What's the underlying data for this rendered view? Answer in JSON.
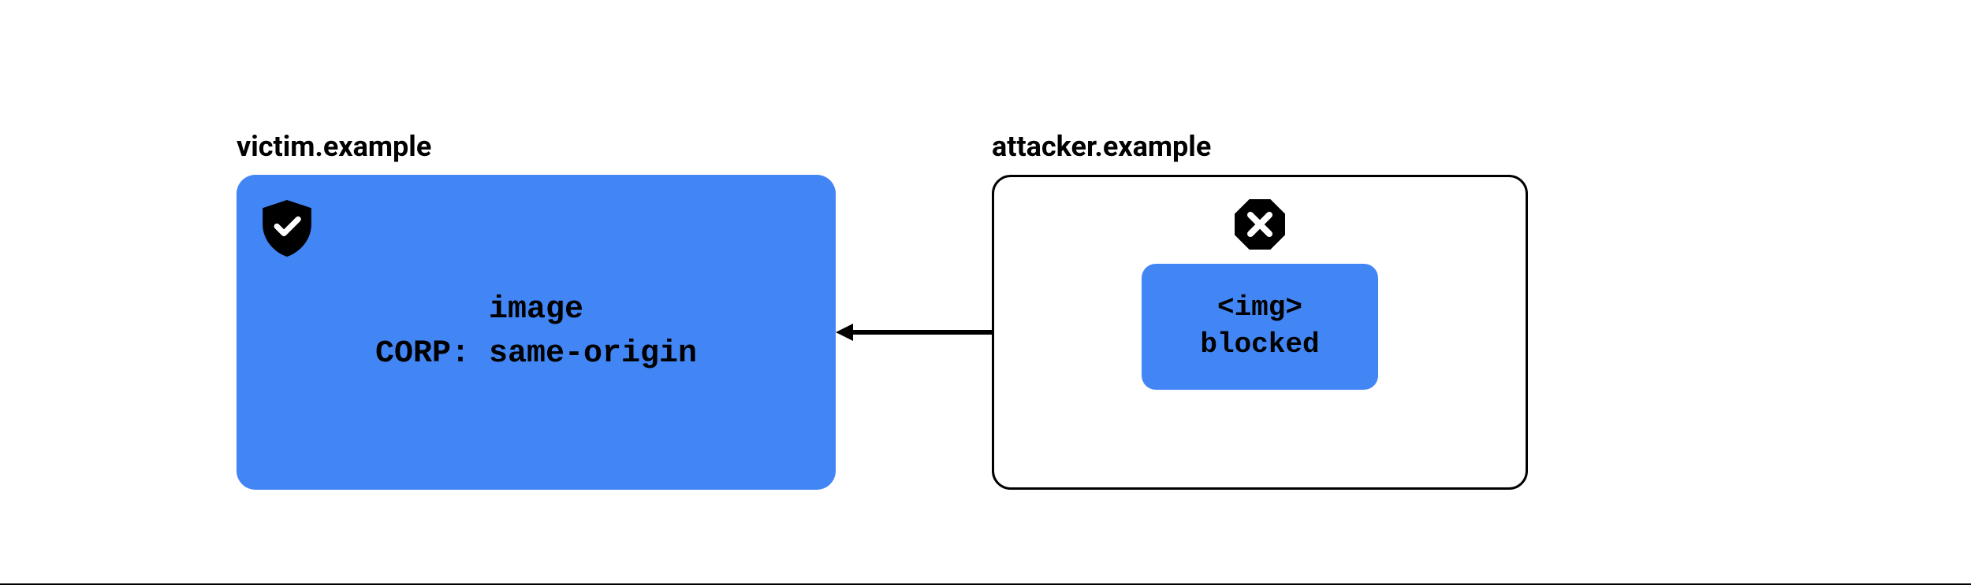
{
  "victim": {
    "label": "victim.example",
    "line1": "image",
    "line2": "CORP: same-origin",
    "icon": "shield-check"
  },
  "attacker": {
    "label": "attacker.example",
    "icon": "block-octagon",
    "inner": {
      "line1": "<img>",
      "line2": "blocked"
    }
  },
  "colors": {
    "accent": "#4285F4",
    "text": "#000000",
    "background": "#ffffff"
  }
}
